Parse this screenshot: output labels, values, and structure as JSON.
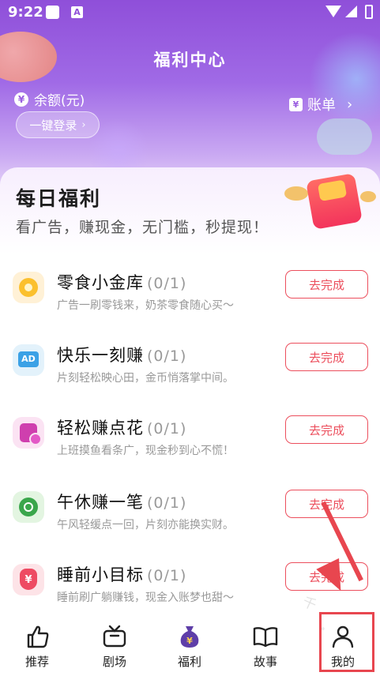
{
  "status_bar": {
    "time": "9:22",
    "notification_letter": "A"
  },
  "header": {
    "title": "福利中心",
    "balance_label": "余额(元)",
    "balance_icon_glyph": "¥",
    "login_button": "一键登录",
    "bill_label": "账单",
    "bill_icon_glyph": "¥"
  },
  "daily": {
    "title": "每日福利",
    "subtitle": "看广告，赚现金，无门槛，秒提现！"
  },
  "tasks": [
    {
      "name": "零食小金库",
      "count": "(0/1)",
      "desc": "广告一刷零钱来，奶茶零食随心买～",
      "button": "去完成",
      "icon": "coin-icon",
      "icon_text": ""
    },
    {
      "name": "快乐一刻赚",
      "count": "(0/1)",
      "desc": "片刻轻松映心田，金币悄落掌中间。",
      "button": "去完成",
      "icon": "ad-icon",
      "icon_text": "AD"
    },
    {
      "name": "轻松赚点花",
      "count": "(0/1)",
      "desc": "上班摸鱼看条广，现金秒到心不慌！",
      "button": "去完成",
      "icon": "database-coin-icon",
      "icon_text": ""
    },
    {
      "name": "午休赚一笔",
      "count": "(0/1)",
      "desc": "午风轻缓点一回，片刻亦能换实财。",
      "button": "去完成",
      "icon": "circle-check-icon",
      "icon_text": ""
    },
    {
      "name": "睡前小目标",
      "count": "(0/1)",
      "desc": "睡前刷广躺赚钱，现金入账梦也甜～",
      "button": "去完成",
      "icon": "money-bag-icon",
      "icon_text": "¥"
    }
  ],
  "tabbar": [
    {
      "label": "推荐",
      "icon": "thumbs-up-icon"
    },
    {
      "label": "剧场",
      "icon": "tv-icon"
    },
    {
      "label": "福利",
      "icon": "money-bag-icon"
    },
    {
      "label": "故事",
      "icon": "book-icon"
    },
    {
      "label": "我的",
      "icon": "user-icon"
    }
  ],
  "overlay": {
    "watermark": "千",
    "watermark_dot": "•"
  },
  "colors": {
    "accent": "#ec4f5d",
    "hero_top": "#8f4fd9",
    "annotation": "#e8464f"
  }
}
